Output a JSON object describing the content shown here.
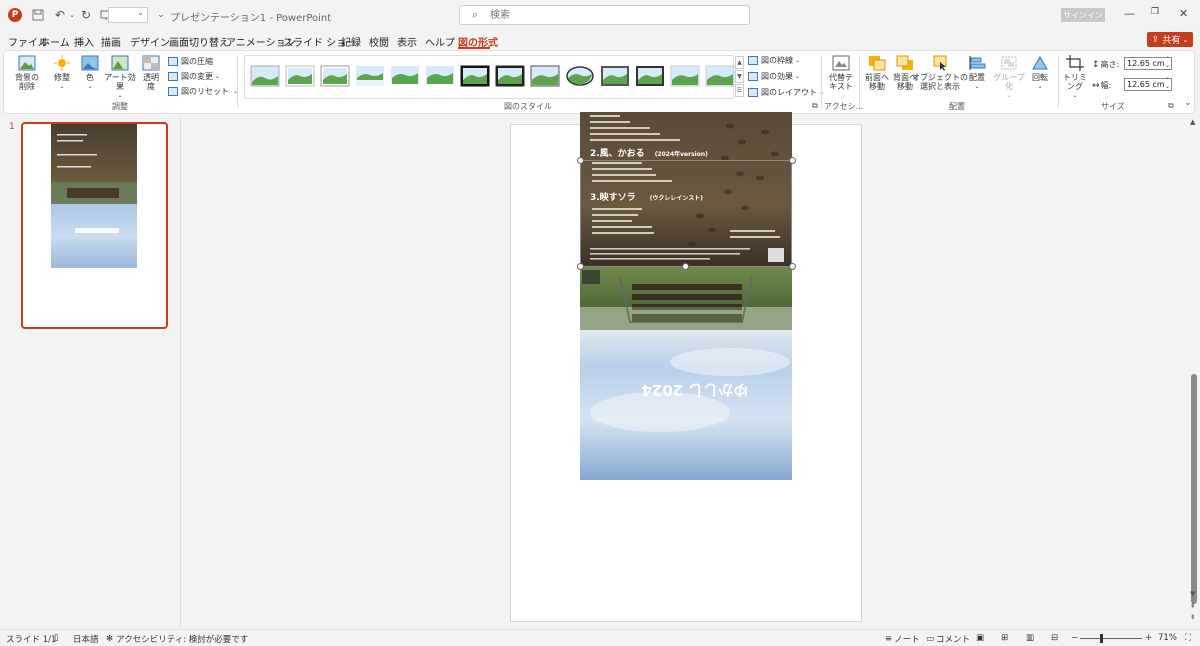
{
  "titlebar": {
    "app_badge": "P",
    "doc_title": "プレゼンテーション1  -  PowerPoint",
    "search_placeholder": "検索",
    "signin": "サインイン"
  },
  "menu": {
    "tabs": [
      {
        "label": "ファイル",
        "active": false
      },
      {
        "label": "ホーム",
        "active": false
      },
      {
        "label": "挿入",
        "active": false
      },
      {
        "label": "描画",
        "active": false
      },
      {
        "label": "デザイン",
        "active": false
      },
      {
        "label": "画面切り替え",
        "active": false
      },
      {
        "label": "アニメーション",
        "active": false
      },
      {
        "label": "スライド ショー",
        "active": false
      },
      {
        "label": "記録",
        "active": false
      },
      {
        "label": "校閲",
        "active": false
      },
      {
        "label": "表示",
        "active": false
      },
      {
        "label": "ヘルプ",
        "active": false
      },
      {
        "label": "図の形式",
        "active": true
      }
    ],
    "share": "共有"
  },
  "ribbon": {
    "adjust": {
      "remove_bg": "背景の\n削除",
      "corrections": "修整",
      "color": "色",
      "artistic": "アート効果",
      "transparency": "透明\n度",
      "compress": "図の圧縮",
      "change": "図の変更",
      "reset": "図のリセット",
      "label": "調整"
    },
    "styles": {
      "label": "図のスタイル",
      "border": "図の枠線",
      "effects": "図の効果",
      "layout": "図のレイアウト"
    },
    "access": {
      "alt_text": "代替テ\nキスト",
      "label": "アクセシ..."
    },
    "arrange": {
      "forward": "前面へ\n移動",
      "backward": "背面へ\n移動",
      "selection": "オブジェクトの\n選択と表示",
      "align": "配置",
      "group": "グループ化",
      "rotate": "回転",
      "label": "配置"
    },
    "size": {
      "crop": "トリミング",
      "height_label": "高さ:",
      "height": "12.65 cm",
      "width_label": "幅:",
      "width": "12.65 cm",
      "label": "サイズ"
    }
  },
  "slide_panel": {
    "number": "1"
  },
  "poster": {
    "track2": "2.風、かおる",
    "track2_sub": "(2024年version)",
    "track3": "3.映すソラ",
    "track3_sub": "(ウクレレインスト)",
    "mirror_title": "ゆかしし 2024"
  },
  "status": {
    "slide": "スライド 1/1",
    "lang": "日本語",
    "accessibility": "アクセシビリティ: 検討が必要です",
    "notes": "ノート",
    "comments": "コメント",
    "zoom": "71%"
  },
  "colors": {
    "accent": "#c43e1c",
    "ribbon_icon": "#3a7ab8"
  }
}
